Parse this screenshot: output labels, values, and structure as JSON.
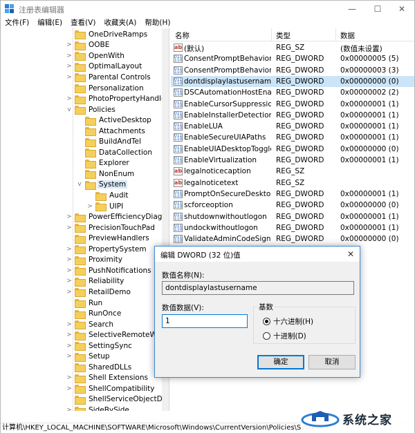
{
  "window": {
    "title": "注册表编辑器",
    "minimize": "—",
    "maximize": "☐",
    "close": "✕"
  },
  "menu": [
    "文件(F)",
    "编辑(E)",
    "查看(V)",
    "收藏夹(A)",
    "帮助(H)"
  ],
  "tree": {
    "items": [
      {
        "label": "OneDriveRamps",
        "chevron": ""
      },
      {
        "label": "OOBE",
        "chevron": ">"
      },
      {
        "label": "OpenWith",
        "chevron": ">"
      },
      {
        "label": "OptimalLayout",
        "chevron": ">"
      },
      {
        "label": "Parental Controls",
        "chevron": ">"
      },
      {
        "label": "Personalization",
        "chevron": ""
      },
      {
        "label": "PhotoPropertyHandler",
        "chevron": ">"
      },
      {
        "label": "Policies",
        "chevron": "v"
      },
      {
        "label": "ActiveDesktop",
        "chevron": ""
      },
      {
        "label": "Attachments",
        "chevron": ""
      },
      {
        "label": "BuildAndTel",
        "chevron": ""
      },
      {
        "label": "DataCollection",
        "chevron": ""
      },
      {
        "label": "Explorer",
        "chevron": ""
      },
      {
        "label": "NonEnum",
        "chevron": ""
      },
      {
        "label": "System",
        "chevron": "v"
      },
      {
        "label": "Audit",
        "chevron": ""
      },
      {
        "label": "UIPI",
        "chevron": ">"
      },
      {
        "label": "PowerEfficiencyDiagnos",
        "chevron": ">"
      },
      {
        "label": "PrecisionTouchPad",
        "chevron": ">"
      },
      {
        "label": "PreviewHandlers",
        "chevron": ""
      },
      {
        "label": "PropertySystem",
        "chevron": ">"
      },
      {
        "label": "Proximity",
        "chevron": ">"
      },
      {
        "label": "PushNotifications",
        "chevron": ">"
      },
      {
        "label": "Reliability",
        "chevron": ">"
      },
      {
        "label": "RetailDemo",
        "chevron": ">"
      },
      {
        "label": "Run",
        "chevron": ""
      },
      {
        "label": "RunOnce",
        "chevron": ""
      },
      {
        "label": "Search",
        "chevron": ">"
      },
      {
        "label": "SelectiveRemoteWipe",
        "chevron": ">"
      },
      {
        "label": "SettingSync",
        "chevron": ">"
      },
      {
        "label": "Setup",
        "chevron": ">"
      },
      {
        "label": "SharedDLLs",
        "chevron": ""
      },
      {
        "label": "Shell Extensions",
        "chevron": ">"
      },
      {
        "label": "ShellCompatibility",
        "chevron": ">"
      },
      {
        "label": "ShellServiceObjectDela",
        "chevron": ""
      },
      {
        "label": "SideBySide",
        "chevron": ">"
      }
    ]
  },
  "list": {
    "headers": {
      "name": "名称",
      "type": "类型",
      "data": "数据"
    },
    "rows": [
      {
        "icon": "ab",
        "name": "(默认)",
        "type": "REG_SZ",
        "data": "(数值未设置)"
      },
      {
        "icon": "dword",
        "name": "ConsentPromptBehaviorA...",
        "type": "REG_DWORD",
        "data": "0x00000005 (5)"
      },
      {
        "icon": "dword",
        "name": "ConsentPromptBehaviorU...",
        "type": "REG_DWORD",
        "data": "0x00000003 (3)"
      },
      {
        "icon": "dword",
        "name": "dontdisplaylastusername",
        "type": "REG_DWORD",
        "data": "0x00000000 (0)"
      },
      {
        "icon": "dword",
        "name": "DSCAutomationHostEnabl...",
        "type": "REG_DWORD",
        "data": "0x00000002 (2)"
      },
      {
        "icon": "dword",
        "name": "EnableCursorSuppression",
        "type": "REG_DWORD",
        "data": "0x00000001 (1)"
      },
      {
        "icon": "dword",
        "name": "EnableInstallerDetection",
        "type": "REG_DWORD",
        "data": "0x00000001 (1)"
      },
      {
        "icon": "dword",
        "name": "EnableLUA",
        "type": "REG_DWORD",
        "data": "0x00000001 (1)"
      },
      {
        "icon": "dword",
        "name": "EnableSecureUIAPaths",
        "type": "REG_DWORD",
        "data": "0x00000001 (1)"
      },
      {
        "icon": "dword",
        "name": "EnableUIADesktopToggle",
        "type": "REG_DWORD",
        "data": "0x00000000 (0)"
      },
      {
        "icon": "dword",
        "name": "EnableVirtualization",
        "type": "REG_DWORD",
        "data": "0x00000001 (1)"
      },
      {
        "icon": "ab",
        "name": "legalnoticecaption",
        "type": "REG_SZ",
        "data": ""
      },
      {
        "icon": "ab",
        "name": "legalnoticetext",
        "type": "REG_SZ",
        "data": ""
      },
      {
        "icon": "dword",
        "name": "PromptOnSecureDesktop",
        "type": "REG_DWORD",
        "data": "0x00000001 (1)"
      },
      {
        "icon": "dword",
        "name": "scforceoption",
        "type": "REG_DWORD",
        "data": "0x00000000 (0)"
      },
      {
        "icon": "dword",
        "name": "shutdownwithoutlogon",
        "type": "REG_DWORD",
        "data": "0x00000001 (1)"
      },
      {
        "icon": "dword",
        "name": "undockwithoutlogon",
        "type": "REG_DWORD",
        "data": "0x00000001 (1)"
      },
      {
        "icon": "dword",
        "name": "ValidateAdminCodeSignat...",
        "type": "REG_DWORD",
        "data": "0x00000000 (0)"
      }
    ]
  },
  "dialog": {
    "title": "编辑 DWORD (32 位)值",
    "close": "✕",
    "name_label": "数值名称(N):",
    "name_value": "dontdisplaylastusername",
    "data_label": "数值数据(V):",
    "data_value": "1",
    "base_label": "基数",
    "hex_label": "十六进制(H)",
    "dec_label": "十进制(D)",
    "ok": "确定",
    "cancel": "取消"
  },
  "status": {
    "path": "计算机\\HKEY_LOCAL_MACHINE\\SOFTWARE\\Microsoft\\Windows\\CurrentVersion\\Policies\\System"
  },
  "watermark": {
    "text": "系统之家"
  }
}
